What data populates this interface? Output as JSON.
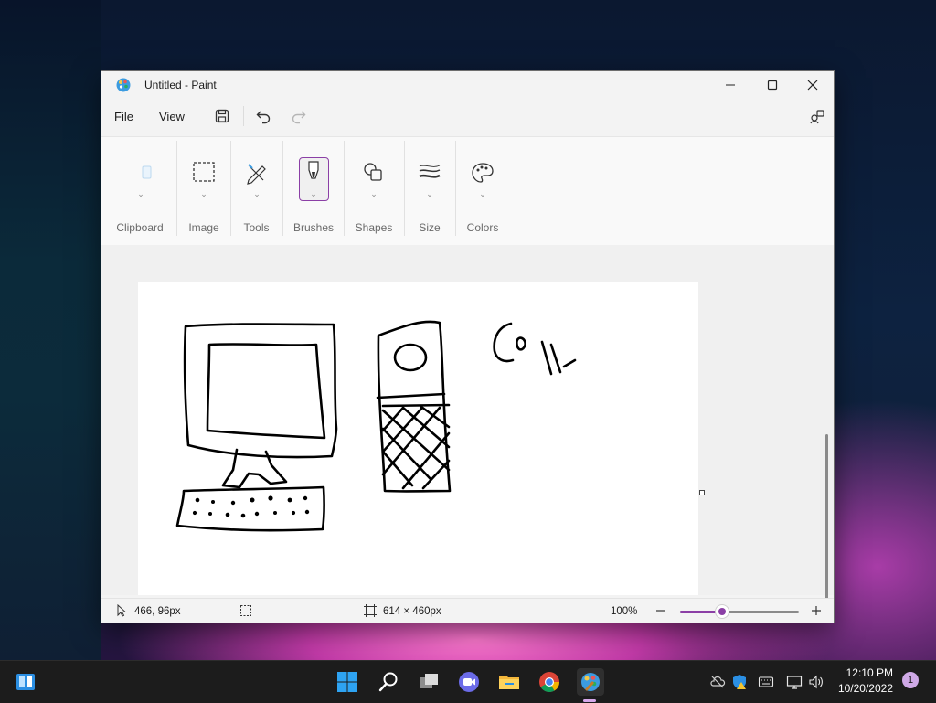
{
  "window": {
    "title": "Untitled - Paint",
    "controls": {
      "minimize": "—",
      "maximize": "☐",
      "close": "✕"
    }
  },
  "menu": {
    "file": "File",
    "view": "View"
  },
  "toolbar": {
    "save_icon": "save-icon",
    "undo_icon": "undo-icon",
    "redo_icon": "redo-icon",
    "share_icon": "share-icon"
  },
  "ribbon": {
    "groups": [
      {
        "label": "Clipboard",
        "icon": "clipboard-icon"
      },
      {
        "label": "Image",
        "icon": "select-icon"
      },
      {
        "label": "Tools",
        "icon": "pencil-icon"
      },
      {
        "label": "Brushes",
        "icon": "brush-icon"
      },
      {
        "label": "Shapes",
        "icon": "shapes-icon"
      },
      {
        "label": "Size",
        "icon": "size-icon"
      },
      {
        "label": "Colors",
        "icon": "palette-icon"
      }
    ],
    "accent": "#8b3fa6"
  },
  "status": {
    "cursor_position": "466, 96px",
    "canvas_size": "614 × 460px",
    "zoom": "100%",
    "zoom_slider_fraction": 0.35
  },
  "taskbar": {
    "apps": [
      "widgets-icon",
      "start-icon",
      "search-icon",
      "task-view-icon",
      "chat-icon",
      "file-explorer-icon",
      "chrome-icon",
      "paint-icon"
    ],
    "time": "12:10 PM",
    "date": "10/20/2022",
    "notification_count": "1"
  }
}
